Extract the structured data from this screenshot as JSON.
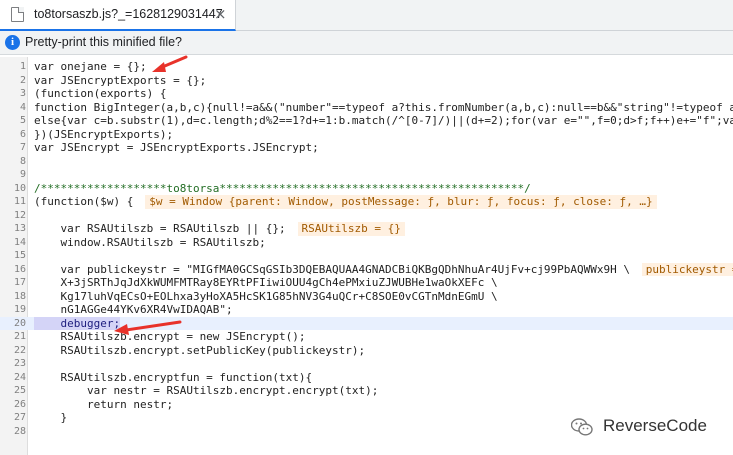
{
  "tab": {
    "filename": "to8torsaszb.js?_=1628129031447",
    "close_glyph": "×"
  },
  "infobar": {
    "icon_glyph": "i",
    "message": "Pretty-print this minified file?"
  },
  "code": {
    "lines": [
      {
        "n": "1",
        "text": "var onejane = {};"
      },
      {
        "n": "2",
        "text": "var JSEncryptExports = {};"
      },
      {
        "n": "3",
        "text": "(function(exports) {"
      },
      {
        "n": "4",
        "text": "function BigInteger(a,b,c){null!=a&&(\"number\"==typeof a?this.fromNumber(a,b,c):null==b&&\"string\"!=typeof a"
      },
      {
        "n": "5",
        "text": "else{var c=b.substr(1),d=c.length;d%2==1?d+=1:b.match(/^[0-7]/)||(d+=2);for(var e=\"\",f=0;d>f;f++)e+=\"f\";va"
      },
      {
        "n": "6",
        "text": "})(JSEncryptExports);"
      },
      {
        "n": "7",
        "text": "var JSEncrypt = JSEncryptExports.JSEncrypt;"
      },
      {
        "n": "8",
        "text": ""
      },
      {
        "n": "9",
        "text": ""
      },
      {
        "n": "10",
        "text": "/*******************to8torsa**********************************************/"
      },
      {
        "n": "11",
        "text": "(function($w) {"
      },
      {
        "n": "12",
        "text": ""
      },
      {
        "n": "13",
        "text": "    var RSAUtilszb = RSAUtilszb || {};"
      },
      {
        "n": "14",
        "text": "    window.RSAUtilszb = RSAUtilszb;"
      },
      {
        "n": "15",
        "text": ""
      },
      {
        "n": "16",
        "text": "    var publickeystr = \"MIGfMA0GCSqGSIb3DQEBAQUAA4GNADCBiQKBgQDhNhuAr4UjFv+cj99PbAQWWx9H \\"
      },
      {
        "n": "17",
        "text": "    X+3jSRThJqJdXkWUMFMTRay8EYRtPFIiwiOUU4gCh4ePMxiuZJWUBHe1waOkXEFc \\"
      },
      {
        "n": "18",
        "text": "    Kg17luhVqECsO+EOLhxa3yHoXA5HcSK1G85hNV3G4uQCr+C8SOE0vCGTnMdnEGmU \\"
      },
      {
        "n": "19",
        "text": "    nG1AGGe44YKv6XR4VwIDAQAB\";"
      },
      {
        "n": "20",
        "text": "    debugger;"
      },
      {
        "n": "21",
        "text": "    RSAUtilszb.encrypt = new JSEncrypt();"
      },
      {
        "n": "22",
        "text": "    RSAUtilszb.encrypt.setPublicKey(publickeystr);"
      },
      {
        "n": "23",
        "text": ""
      },
      {
        "n": "24",
        "text": "    RSAUtilszb.encryptfun = function(txt){"
      },
      {
        "n": "25",
        "text": "        var nestr = RSAUtilszb.encrypt.encrypt(txt);"
      },
      {
        "n": "26",
        "text": "        return nestr;"
      },
      {
        "n": "27",
        "text": "    }"
      },
      {
        "n": "28",
        "text": ""
      }
    ],
    "inline_values": [
      {
        "line": "11",
        "text": "$w = Window {parent: Window, postMessage: ƒ, blur: ƒ, focus: ƒ, close: ƒ, …}"
      },
      {
        "line": "13",
        "text": "RSAUtilszb = {}"
      },
      {
        "line": "16",
        "text": "publickeystr = "
      }
    ],
    "debugger_line": "20"
  },
  "watermark": {
    "text": "ReverseCode"
  },
  "colors": {
    "arrow": "#e8322a",
    "tab_accent": "#1a73e8",
    "info_icon": "#1a73e8"
  }
}
